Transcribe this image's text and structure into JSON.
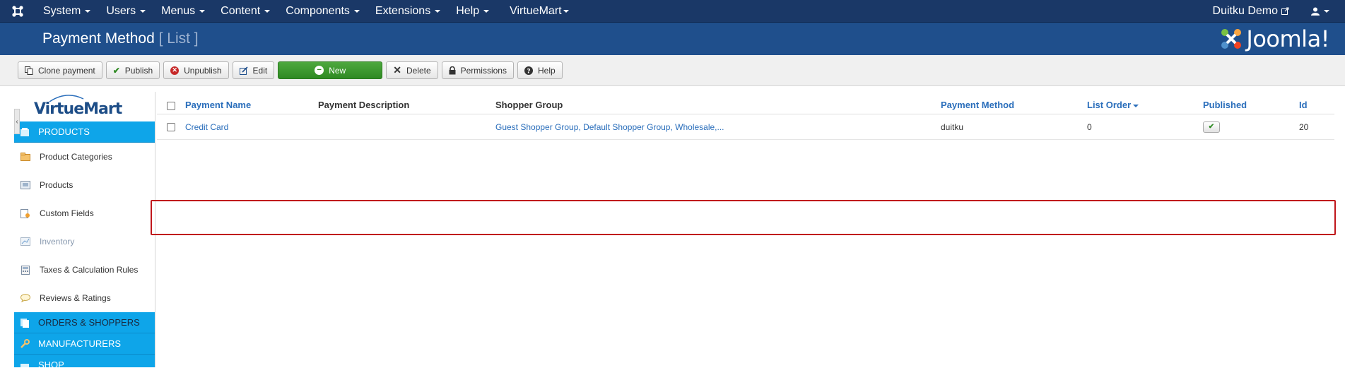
{
  "topnav": {
    "menus": [
      "System",
      "Users",
      "Menus",
      "Content",
      "Components",
      "Extensions",
      "Help",
      "VirtueMart"
    ],
    "site_link": "Duitku Demo"
  },
  "titlebar": {
    "title": "Payment Method",
    "subtitle": "[ List ]",
    "brand": "Joomla!"
  },
  "toolbar": {
    "clone": "Clone payment",
    "publish": "Publish",
    "unpublish": "Unpublish",
    "edit": "Edit",
    "new": "New",
    "delete": "Delete",
    "permissions": "Permissions",
    "help": "Help"
  },
  "sidebar": {
    "logo": "VirtueMart",
    "products_section": "PRODUCTS",
    "items": [
      {
        "label": "Product Categories",
        "icon": "categories-icon"
      },
      {
        "label": "Products",
        "icon": "products-icon"
      },
      {
        "label": "Custom Fields",
        "icon": "custom-fields-icon"
      },
      {
        "label": "Inventory",
        "icon": "inventory-icon"
      },
      {
        "label": "Taxes & Calculation Rules",
        "icon": "calculator-icon"
      },
      {
        "label": "Reviews & Ratings",
        "icon": "reviews-icon"
      }
    ],
    "orders_section": "ORDERS & SHOPPERS",
    "manufacturers_section": "MANUFACTURERS",
    "shop_section": "SHOP"
  },
  "table": {
    "headers": {
      "name": "Payment Name",
      "description": "Payment Description",
      "shopper_group": "Shopper Group",
      "method": "Payment Method",
      "list_order": "List Order",
      "published": "Published",
      "id": "Id"
    },
    "rows": [
      {
        "name": "Credit Card",
        "description": "",
        "shopper_group": "Guest Shopper Group, Default Shopper Group, Wholesale,...",
        "method": "duitku",
        "list_order": "0",
        "published": true,
        "id": "20"
      }
    ]
  },
  "colors": {
    "topnav": "#1a3867",
    "titlebar": "#1f4f8c",
    "sidebar_section": "#0ea5e9",
    "new_button": "#2f8a23",
    "highlight": "#c0161b",
    "link": "#2a6ebb"
  }
}
